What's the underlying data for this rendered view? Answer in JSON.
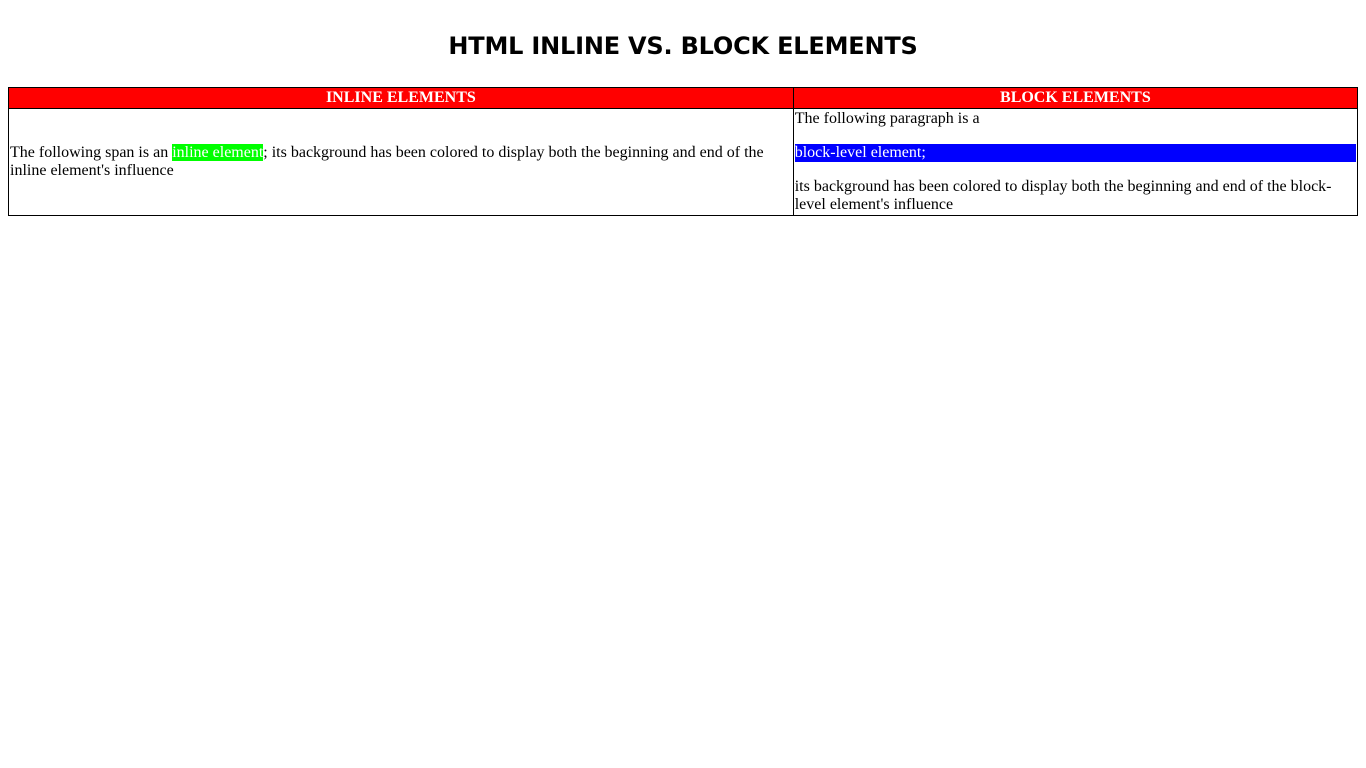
{
  "page": {
    "title": "HTML INLINE VS. BLOCK ELEMENTS"
  },
  "table": {
    "headers": [
      "INLINE ELEMENTS",
      "BLOCK ELEMENTS"
    ],
    "inline_cell": {
      "before": "The following span is an ",
      "highlight": "inline element",
      "after": "; its background has been colored to display both the beginning and end of the inline element's influence"
    },
    "block_cell": {
      "intro": "The following paragraph is a",
      "highlight": "block-level element;",
      "outro": "its background has been colored to display both the beginning and end of the block-level element's influence"
    }
  },
  "colors": {
    "header_bg": "#ff0000",
    "inline_highlight_bg": "#00ff00",
    "block_highlight_bg": "#0000ff",
    "highlight_text": "#ffffff"
  }
}
